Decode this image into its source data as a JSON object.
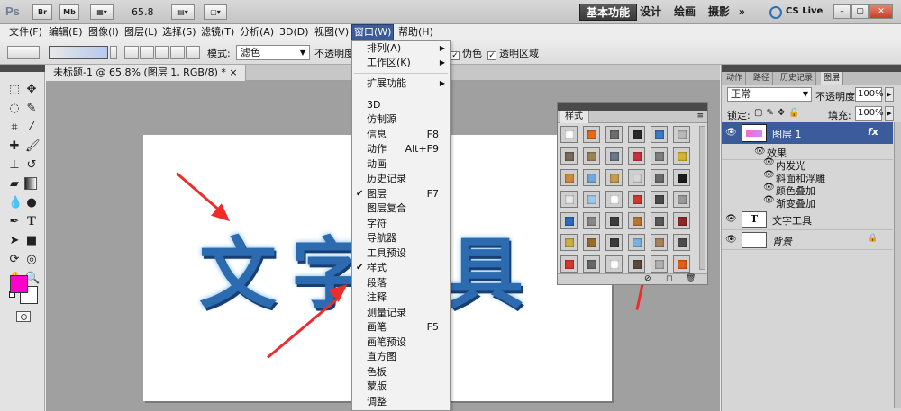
{
  "appbar": {
    "logo": "Ps",
    "btn_br": "Br",
    "btn_mb": "Mb",
    "zoom": "65.8",
    "workspaces": [
      "基本功能",
      "设计",
      "绘画",
      "摄影"
    ],
    "more": "»",
    "cslive": "CS Live"
  },
  "menubar": {
    "items": [
      "文件(F)",
      "编辑(E)",
      "图像(I)",
      "图层(L)",
      "选择(S)",
      "滤镜(T)",
      "分析(A)",
      "3D(D)",
      "视图(V)",
      "窗口(W)",
      "帮助(H)"
    ]
  },
  "options": {
    "mode_label": "模式:",
    "mode_value": "滤色",
    "opacity_label": "不透明度",
    "dither_label": "伪色",
    "transparency_label": "透明区域"
  },
  "document": {
    "tab_title": "未标题-1 @ 65.8% (图层 1, RGB/8) *",
    "chars": [
      "文",
      "字",
      "具"
    ]
  },
  "window_menu": {
    "items": [
      {
        "label": "排列(A)",
        "submenu": true
      },
      {
        "label": "工作区(K)",
        "submenu": true
      },
      {
        "label": "扩展功能",
        "submenu": true
      },
      {
        "label": "3D"
      },
      {
        "label": "仿制源"
      },
      {
        "label": "信息",
        "shortcut": "F8"
      },
      {
        "label": "动作",
        "shortcut": "Alt+F9"
      },
      {
        "label": "动画"
      },
      {
        "label": "历史记录"
      },
      {
        "label": "图层",
        "shortcut": "F7",
        "checked": true
      },
      {
        "label": "图层复合"
      },
      {
        "label": "字符"
      },
      {
        "label": "导航器"
      },
      {
        "label": "工具预设"
      },
      {
        "label": "样式",
        "checked": true
      },
      {
        "label": "段落"
      },
      {
        "label": "注释"
      },
      {
        "label": "测量记录"
      },
      {
        "label": "画笔",
        "shortcut": "F5"
      },
      {
        "label": "画笔预设"
      },
      {
        "label": "直方图"
      },
      {
        "label": "色板"
      },
      {
        "label": "蒙版"
      },
      {
        "label": "调整"
      }
    ]
  },
  "styles_panel": {
    "tab": "样式",
    "swatch_colors": [
      "#ffffff",
      "#e56a1a",
      "#6d6d6d",
      "#2a2a2a",
      "#3a78c8",
      "#b8b8b8",
      "#7a6b5a",
      "#9c8554",
      "#6a7a8a",
      "#c8323a",
      "#7f7f7f",
      "#d8b530",
      "#d08a3a",
      "#6fa8dc",
      "#c79c4f",
      "#d7d7d7",
      "#6a6a6a",
      "#1c1c1c",
      "#e8e8e8",
      "#a0c8e8",
      "#ffffff",
      "#c83c2c",
      "#4a4a4a",
      "#9a9a9a",
      "#2d6bbf",
      "#888888",
      "#3d3d3d",
      "#b9762f",
      "#5a5a5a",
      "#8a2a2a",
      "#c8b040",
      "#9a6b2b",
      "#3c3c3c",
      "#7ab0e0",
      "#a5825a",
      "#4d4d4d",
      "#d23a2a",
      "#666666",
      "#ffffff",
      "#5a4a3a",
      "#b0b0b0",
      "#e0601a"
    ]
  },
  "layers_panel": {
    "tabs": [
      "动作",
      "路径",
      "历史记录",
      "图层"
    ],
    "blend_mode": "正常",
    "opacity_label": "不透明度:",
    "opacity_value": "100%",
    "lock_label": "锁定:",
    "fill_label": "填充:",
    "fill_value": "100%",
    "layers": [
      {
        "name": "图层 1",
        "selected": true,
        "fx": "fx"
      },
      {
        "name": "效果",
        "effect_group": true
      },
      {
        "name": "内发光",
        "effect": true
      },
      {
        "name": "斜面和浮雕",
        "effect": true
      },
      {
        "name": "颜色叠加",
        "effect": true
      },
      {
        "name": "渐变叠加",
        "effect": true
      },
      {
        "name": "文字工具",
        "type": "text",
        "thumb": "T"
      },
      {
        "name": "背景",
        "background": true
      }
    ]
  },
  "colors": {
    "accent": "#3b5b9b",
    "foreground": "#ff00cc",
    "arrow": "#ee2c2c"
  }
}
